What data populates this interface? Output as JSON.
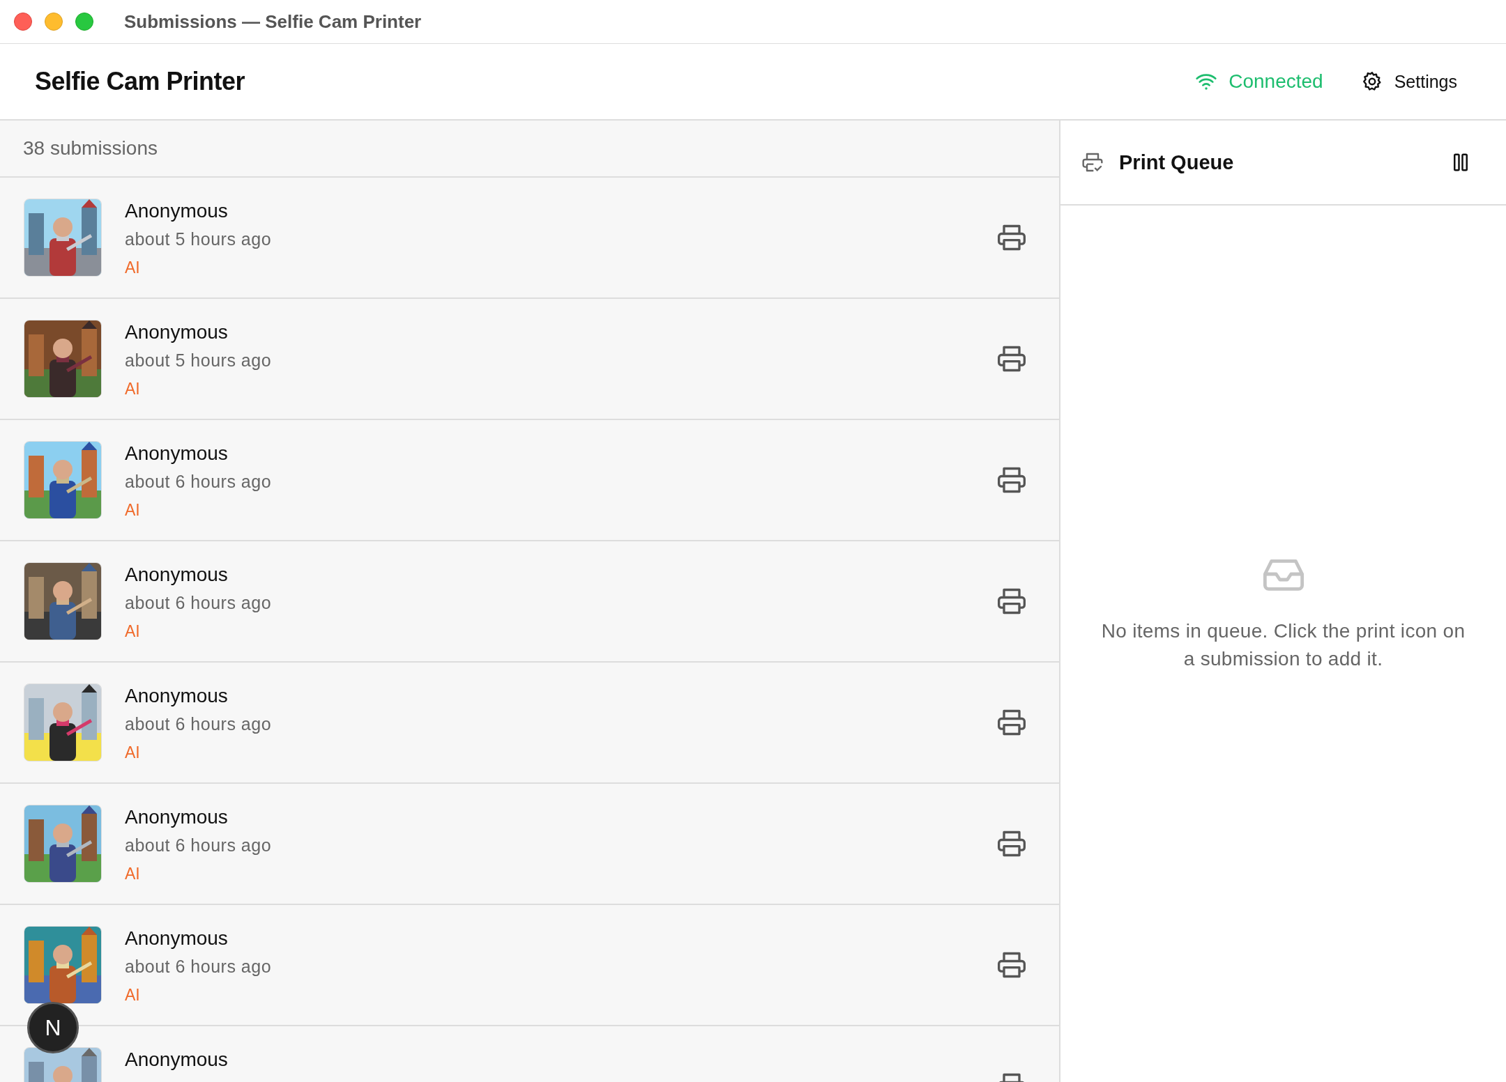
{
  "window": {
    "title": "Submissions — Selfie Cam Printer"
  },
  "header": {
    "title": "Selfie Cam Printer",
    "connection": {
      "label": "Connected",
      "connected": true
    },
    "settings": "Settings"
  },
  "submissions": {
    "count": "38 submissions",
    "rows": [
      {
        "name": "Anonymous",
        "time": "about 5 hours ago",
        "tag": "AI"
      },
      {
        "name": "Anonymous",
        "time": "about 5 hours ago",
        "tag": "AI"
      },
      {
        "name": "Anonymous",
        "time": "about 6 hours ago",
        "tag": "AI"
      },
      {
        "name": "Anonymous",
        "time": "about 6 hours ago",
        "tag": "AI"
      },
      {
        "name": "Anonymous",
        "time": "about 6 hours ago",
        "tag": "AI"
      },
      {
        "name": "Anonymous",
        "time": "about 6 hours ago",
        "tag": "AI"
      },
      {
        "name": "Anonymous",
        "time": "about 6 hours ago",
        "tag": "AI"
      },
      {
        "name": "Anonymous"
      }
    ]
  },
  "print_queue": {
    "title": "Print Queue",
    "empty_message": "No items in queue. Click the print icon on a submission to add it."
  },
  "dev_badge": "N"
}
